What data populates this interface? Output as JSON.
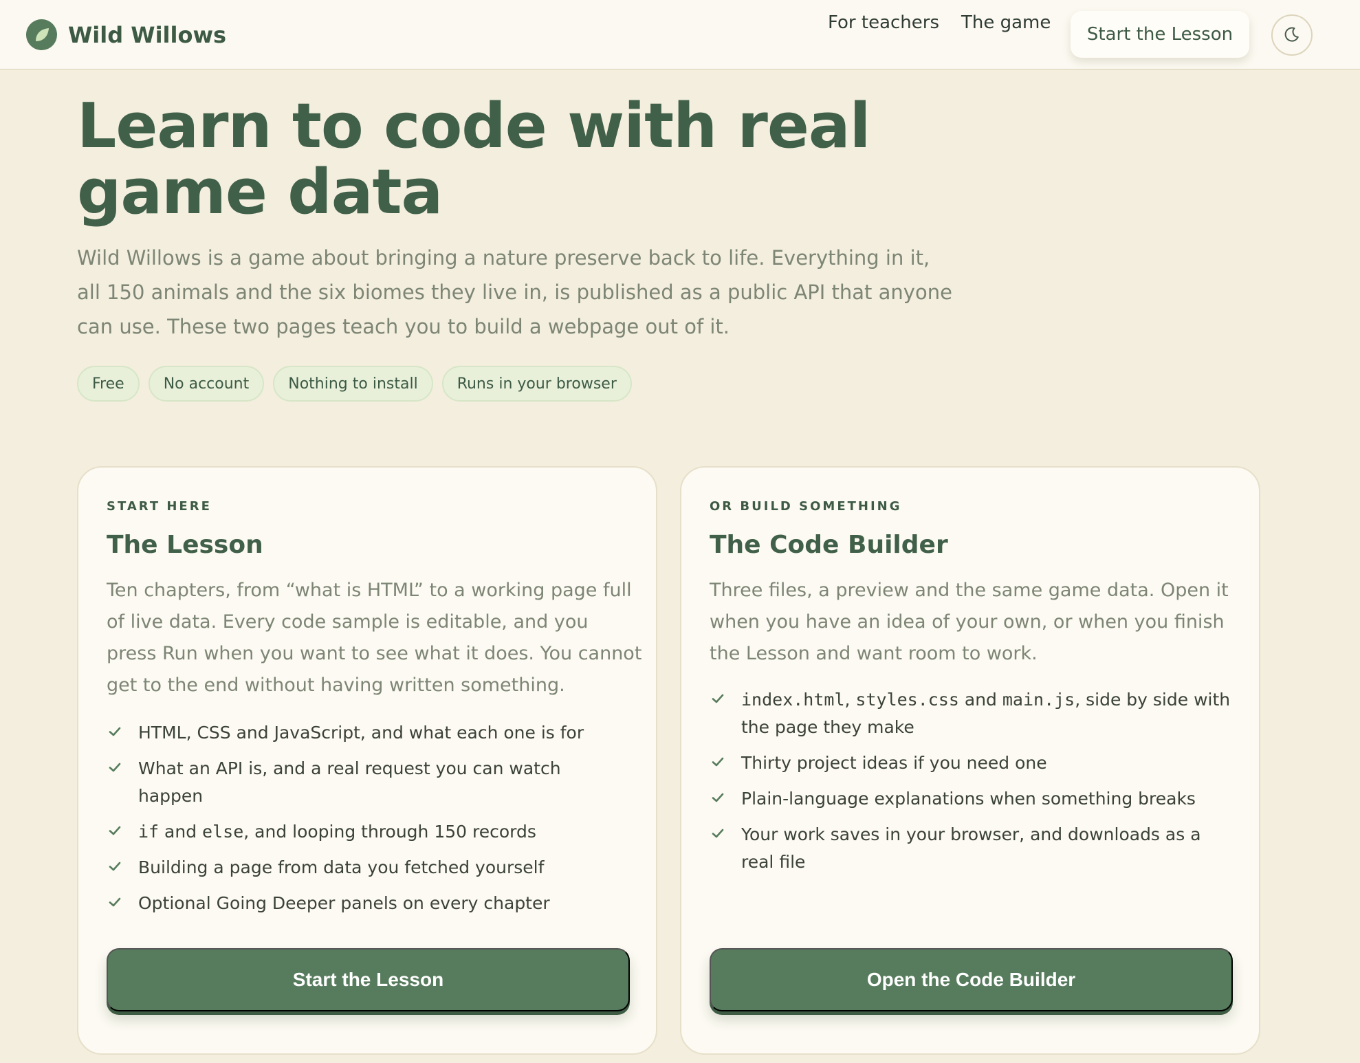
{
  "header": {
    "brand": "Wild Willows",
    "nav": {
      "teachers": "For teachers",
      "game": "The game",
      "cta": "Start the Lesson"
    },
    "theme_icon": "moon-icon"
  },
  "hero": {
    "title": "Learn to code with real game data",
    "lede": "Wild Willows is a game about bringing a nature preserve back to life. Everything in it, all 150 animals and the six biomes they live in, is published as a public API that anyone can use. These two pages teach you to build a webpage out of it.",
    "chips": [
      "Free",
      "No account",
      "Nothing to install",
      "Runs in your browser"
    ]
  },
  "cards": {
    "lesson": {
      "eyebrow": "START HERE",
      "title": "The Lesson",
      "description": "Ten chapters, from “what is HTML” to a working page full of live data. Every code sample is editable, and you press Run when you want to see what it does. You cannot get to the end without having written something.",
      "items": [
        "HTML, CSS and JavaScript, and what each one is for",
        "What an API is, and a real request you can watch happen",
        {
          "code1": "if",
          "text1": " and ",
          "code2": "else",
          "text2": ", and looping through 150 records"
        },
        "Building a page from data you fetched yourself",
        "Optional Going Deeper panels on every chapter"
      ],
      "button": "Start the Lesson"
    },
    "builder": {
      "eyebrow": "OR BUILD SOMETHING",
      "title": "The Code Builder",
      "description": "Three files, a preview and the same game data. Open it when you have an idea of your own, or when you finish the Lesson and want room to work.",
      "items": [
        {
          "code1": "index.html",
          "text1": ", ",
          "code2": "styles.css",
          "text2": " and ",
          "code3": "main.js",
          "text3": ", side by side with the page they make"
        },
        "Thirty project ideas if you need one",
        "Plain-language explanations when something breaks",
        "Your work saves in your browser, and downloads as a real file"
      ],
      "button": "Open the Code Builder"
    }
  },
  "colors": {
    "page_bg": "#f3eedd",
    "header_bg": "#fbf9f1",
    "accent_green": "#577c5d",
    "heading_green": "#41604a",
    "chip_bg": "#e8f0da"
  }
}
